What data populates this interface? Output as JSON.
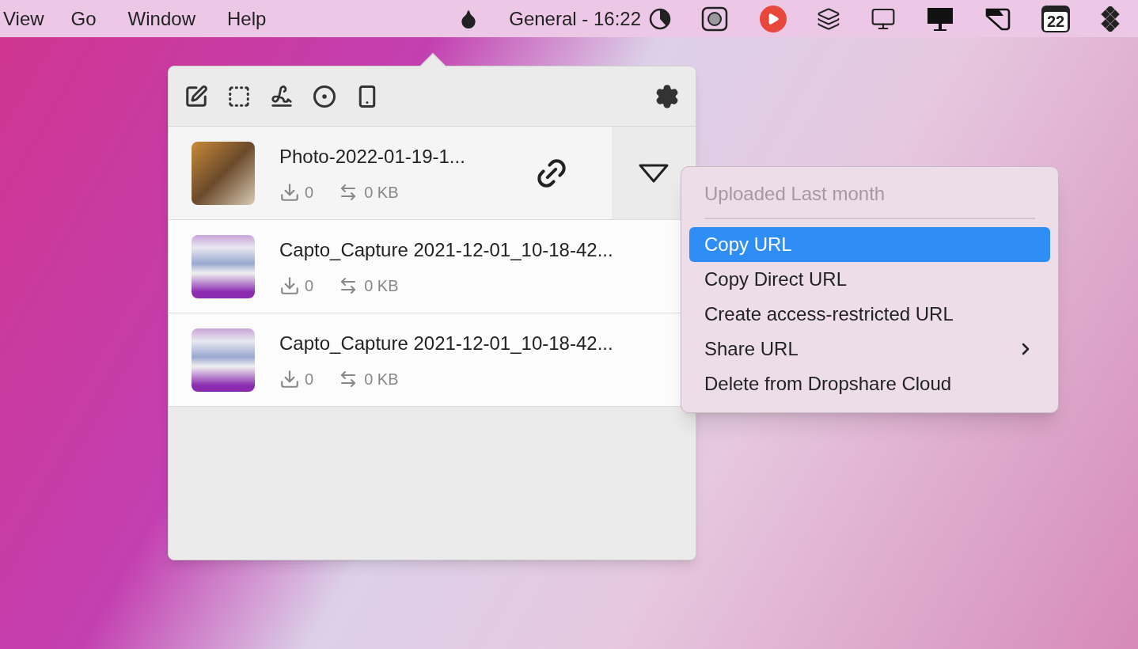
{
  "menu_bar": {
    "menus": [
      "View",
      "Go",
      "Window",
      "Help"
    ],
    "status_text": "General - 16:22",
    "calendar_day": "22"
  },
  "popover": {
    "files": [
      {
        "name": "Photo-2022-01-19-1...",
        "downloads": "0",
        "size": "0 KB",
        "kind": "photo",
        "hovered": true
      },
      {
        "name": "Capto_Capture 2021-12-01_10-18-42...",
        "downloads": "0",
        "size": "0 KB",
        "kind": "screenshot",
        "hovered": false
      },
      {
        "name": "Capto_Capture 2021-12-01_10-18-42...",
        "downloads": "0",
        "size": "0 KB",
        "kind": "screenshot",
        "hovered": false
      }
    ]
  },
  "context_menu": {
    "header": "Uploaded Last month",
    "items": [
      {
        "label": "Copy URL",
        "selected": true,
        "submenu": false
      },
      {
        "label": "Copy Direct URL",
        "selected": false,
        "submenu": false
      },
      {
        "label": "Create access-restricted URL",
        "selected": false,
        "submenu": false
      },
      {
        "label": "Share URL",
        "selected": false,
        "submenu": true
      },
      {
        "label": "Delete from Dropshare Cloud",
        "selected": false,
        "submenu": false
      }
    ]
  }
}
